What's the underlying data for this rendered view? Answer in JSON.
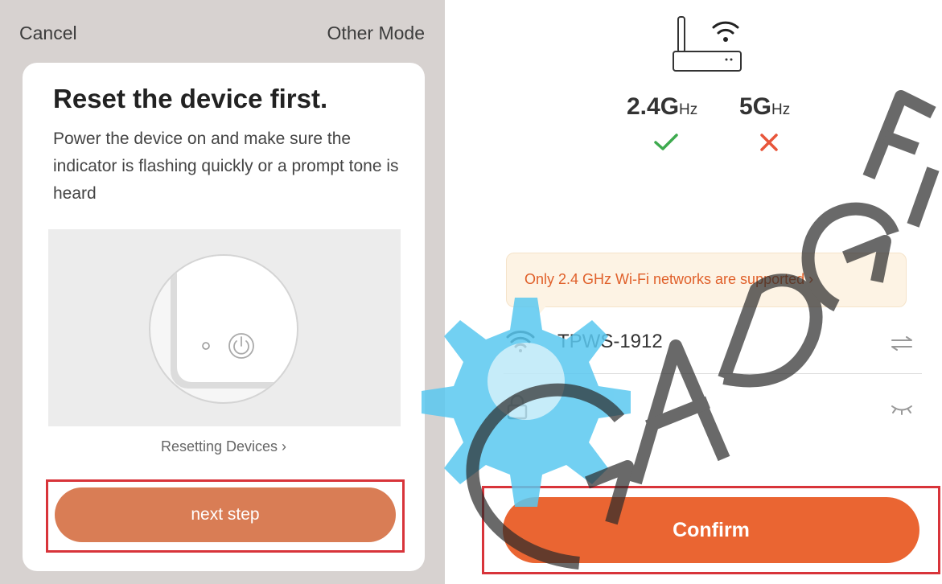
{
  "left": {
    "cancel_label": "Cancel",
    "other_mode_label": "Other Mode",
    "title": "Reset the device first.",
    "description": "Power the device on and make sure the indicator is flashing quickly or a prompt tone is heard",
    "resetting_link": "Resetting Devices ›",
    "next_label": "next step"
  },
  "right": {
    "band_24": {
      "value": "2.4G",
      "unit": "Hz",
      "status": "supported",
      "status_color": "#3daa4e"
    },
    "band_5": {
      "value": "5G",
      "unit": "Hz",
      "status": "unsupported",
      "status_color": "#e8553a"
    },
    "notice": "Only 2.4 GHz Wi-Fi networks are supported ›",
    "ssid": "TPWS-1912",
    "password_value": "",
    "password_placeholder": "",
    "confirm_label": "Confirm"
  },
  "watermark": {
    "text": "GADGET PI",
    "color": "#2a2a2a",
    "gear_color": "#5ac8f0"
  },
  "colors": {
    "accent_left": "#d97d55",
    "accent_right": "#ea6532",
    "highlight": "#d8343a"
  },
  "icons": [
    "router-icon",
    "check-icon",
    "cross-icon",
    "wifi-icon",
    "switch-network-icon",
    "lock-icon",
    "eye-closed-icon",
    "power-icon"
  ]
}
